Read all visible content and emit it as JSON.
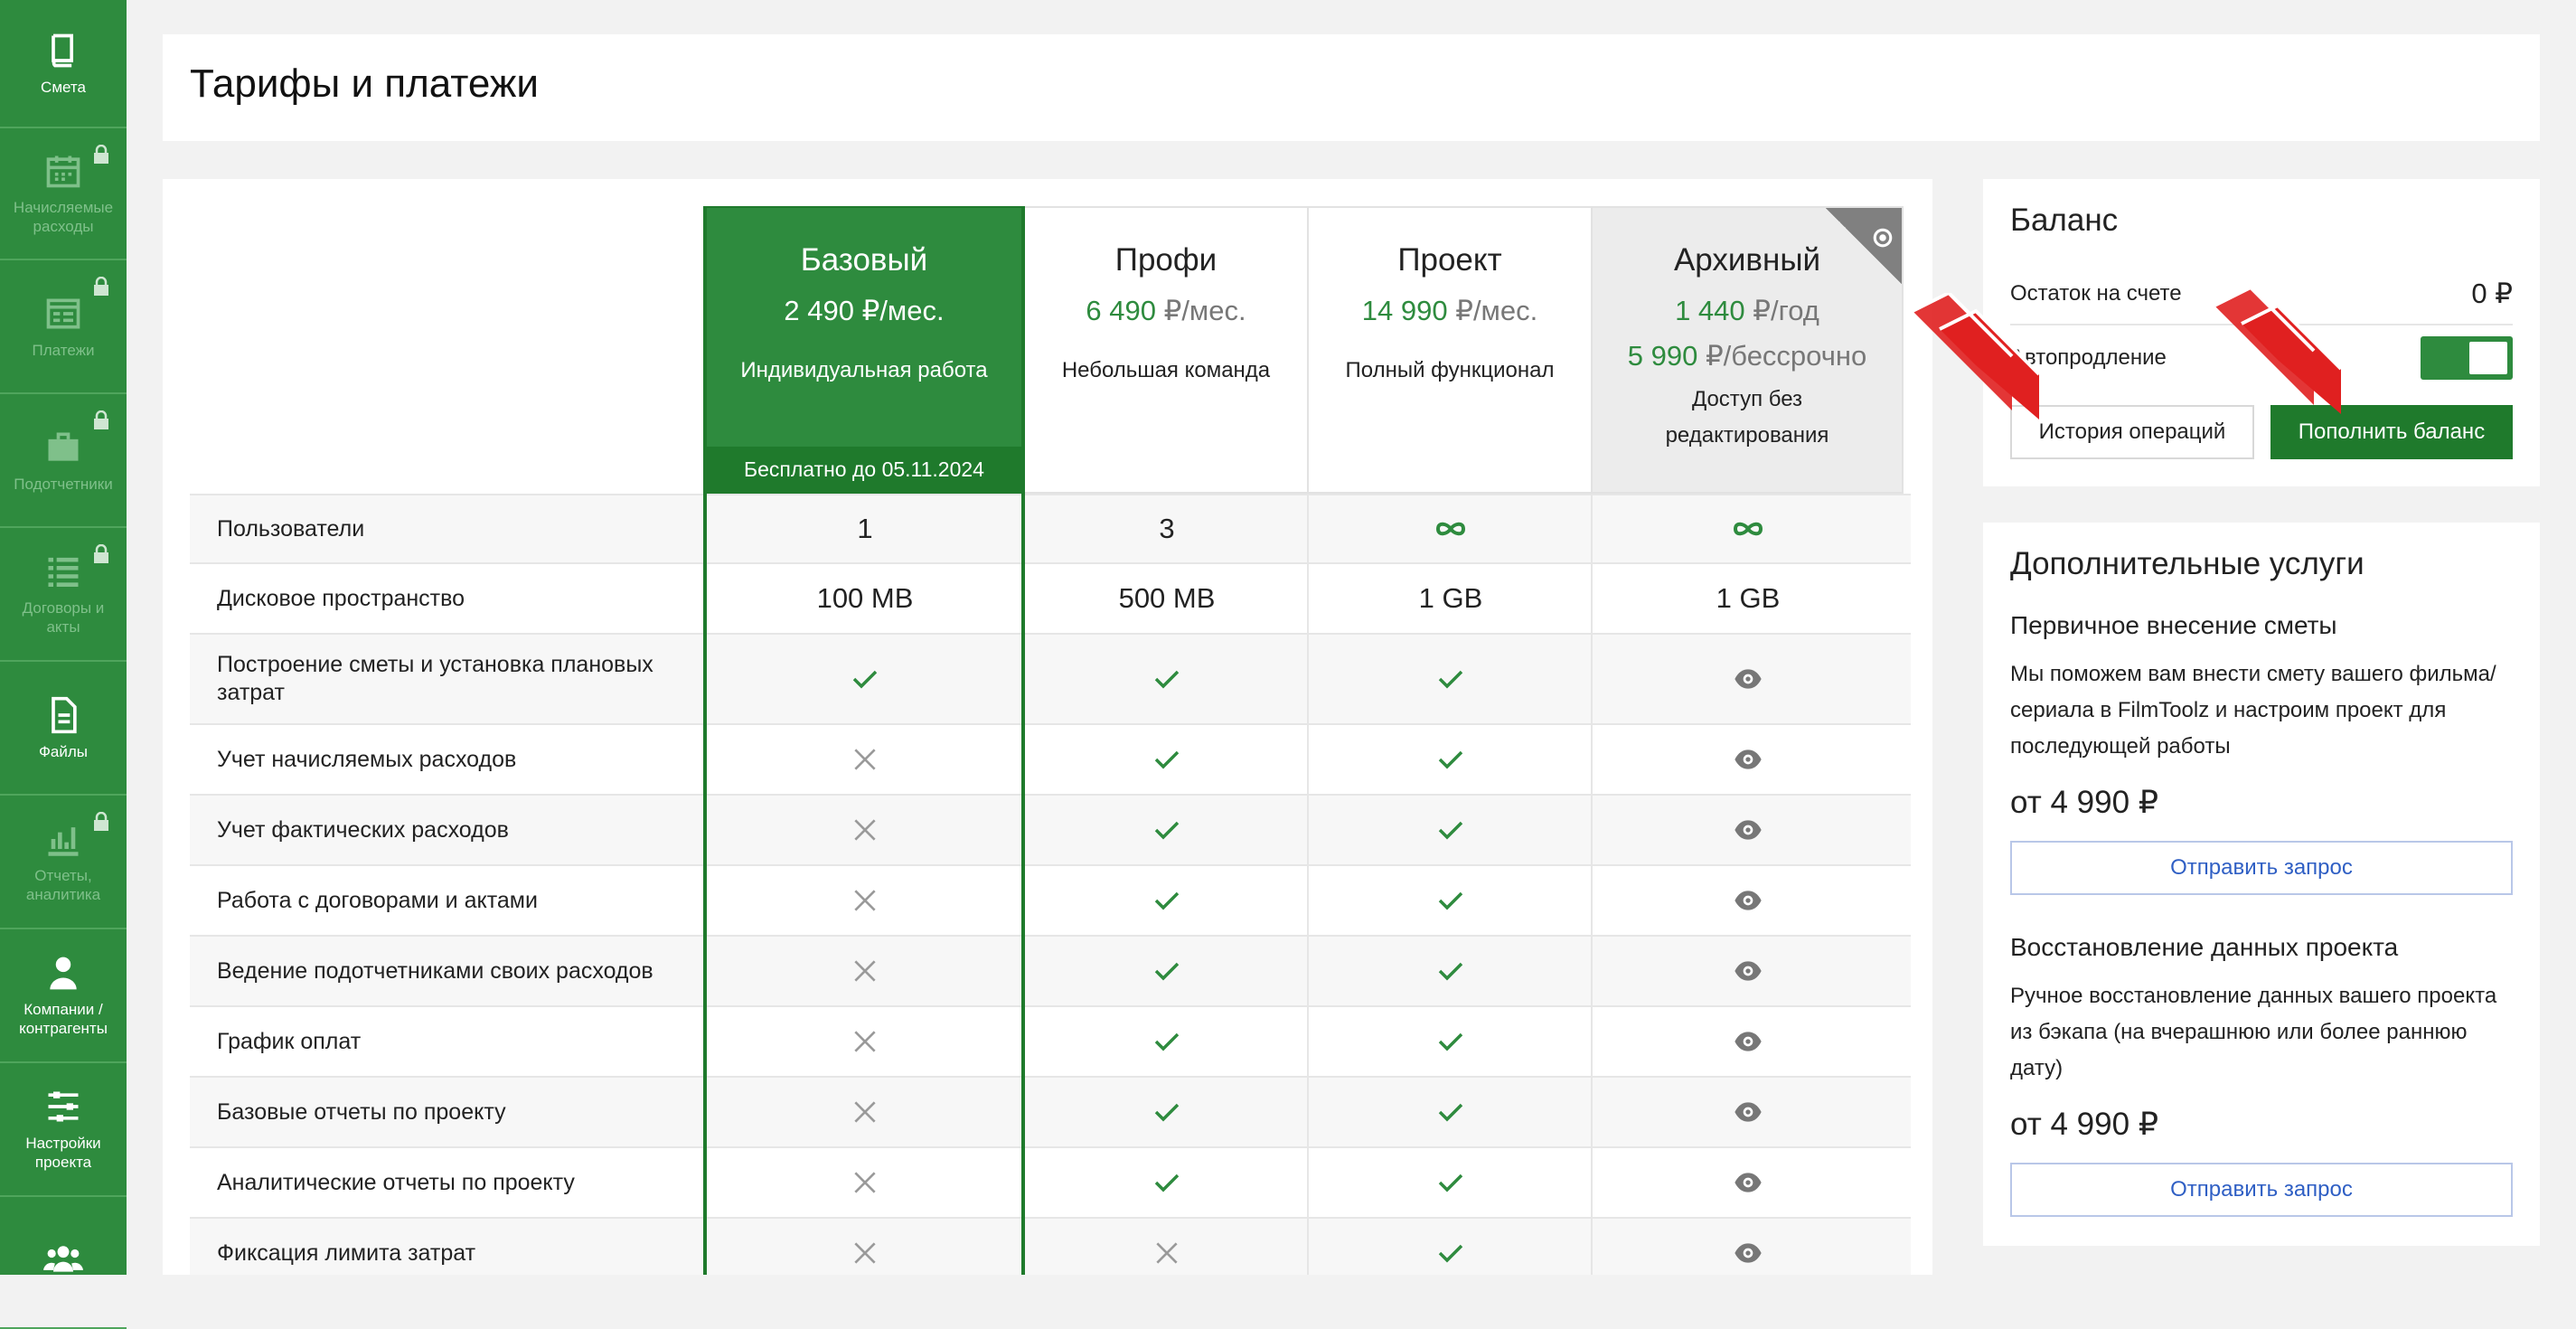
{
  "sidebar": {
    "items": [
      {
        "label": "Смета",
        "icon": "book-icon",
        "locked": false
      },
      {
        "label": "Начисляемые расходы",
        "icon": "calendar-icon",
        "locked": true
      },
      {
        "label": "Платежи",
        "icon": "payments-list-icon",
        "locked": true
      },
      {
        "label": "Подотчетники",
        "icon": "briefcase-icon",
        "locked": true
      },
      {
        "label": "Договоры и акты",
        "icon": "list-icon",
        "locked": true
      },
      {
        "label": "Файлы",
        "icon": "file-icon",
        "locked": false
      },
      {
        "label": "Отчеты, аналитика",
        "icon": "bar-chart-icon",
        "locked": true
      },
      {
        "label": "Компании / контрагенты",
        "icon": "user-icon",
        "locked": false
      },
      {
        "label": "Настройки проекта",
        "icon": "sliders-icon",
        "locked": false
      },
      {
        "label": "",
        "icon": "group-icon",
        "locked": false
      }
    ]
  },
  "page": {
    "title": "Тарифы и платежи"
  },
  "plans": [
    {
      "name": "Базовый",
      "price_num": "2 490",
      "price_unit": "₽/мес.",
      "desc": "Индивидуальная работа",
      "badge": "Бесплатно до 05.11.2024"
    },
    {
      "name": "Профи",
      "price_num": "6 490",
      "price_unit": "₽/мес.",
      "desc": "Небольшая команда"
    },
    {
      "name": "Проект",
      "price_num": "14 990",
      "price_unit": "₽/мес.",
      "desc": "Полный функционал"
    },
    {
      "name": "Архивный",
      "price_num": "1 440",
      "price_unit": "₽/год",
      "price2_num": "5 990",
      "price2_unit": "₽/бессрочно",
      "desc": "Доступ без редактирования"
    }
  ],
  "features": [
    {
      "label": "Пользователи",
      "values": [
        "1",
        "3",
        "inf",
        "inf"
      ]
    },
    {
      "label": "Дисковое пространство",
      "values": [
        "100 MB",
        "500 MB",
        "1 GB",
        "1 GB"
      ]
    },
    {
      "label": "Построение сметы и установка плановых затрат",
      "values": [
        "check",
        "check",
        "check",
        "eye"
      ]
    },
    {
      "label": "Учет начисляемых расходов",
      "values": [
        "cross",
        "check",
        "check",
        "eye"
      ]
    },
    {
      "label": "Учет фактических расходов",
      "values": [
        "cross",
        "check",
        "check",
        "eye"
      ]
    },
    {
      "label": "Работа с договорами и актами",
      "values": [
        "cross",
        "check",
        "check",
        "eye"
      ]
    },
    {
      "label": "Ведение подотчетниками своих расходов",
      "values": [
        "cross",
        "check",
        "check",
        "eye"
      ]
    },
    {
      "label": "График оплат",
      "values": [
        "cross",
        "check",
        "check",
        "eye"
      ]
    },
    {
      "label": "Базовые отчеты по проекту",
      "values": [
        "cross",
        "check",
        "check",
        "eye"
      ]
    },
    {
      "label": "Аналитические отчеты по проекту",
      "values": [
        "cross",
        "check",
        "check",
        "eye"
      ]
    },
    {
      "label": "Фиксация лимита затрат",
      "values": [
        "cross",
        "cross",
        "check",
        "eye"
      ]
    }
  ],
  "balance": {
    "title": "Баланс",
    "remaining_label": "Остаток на счете",
    "remaining_value": "0 ₽",
    "autorenew_label": "Автопродление",
    "autorenew_on": true,
    "history_button": "История операций",
    "topup_button": "Пополнить баланс"
  },
  "services": {
    "title": "Дополнительные услуги",
    "items": [
      {
        "title": "Первичное внесение сметы",
        "text": "Мы поможем вам внести смету вашего фильма/сериала в FilmToolz и настроим проект для последующей работы",
        "price": "от 4 990 ₽",
        "button": "Отправить запрос"
      },
      {
        "title": "Восстановление данных проекта",
        "text": "Ручное восстановление данных вашего проекта из бэкапа (на вчерашнюю или более раннюю дату)",
        "price": "от 4 990 ₽",
        "button": "Отправить запрос"
      }
    ]
  },
  "colors": {
    "brand_green": "#2e8b3e",
    "dark_green": "#1f7a2c",
    "annotation_red": "#e02020",
    "link_blue": "#2f5fc4"
  }
}
